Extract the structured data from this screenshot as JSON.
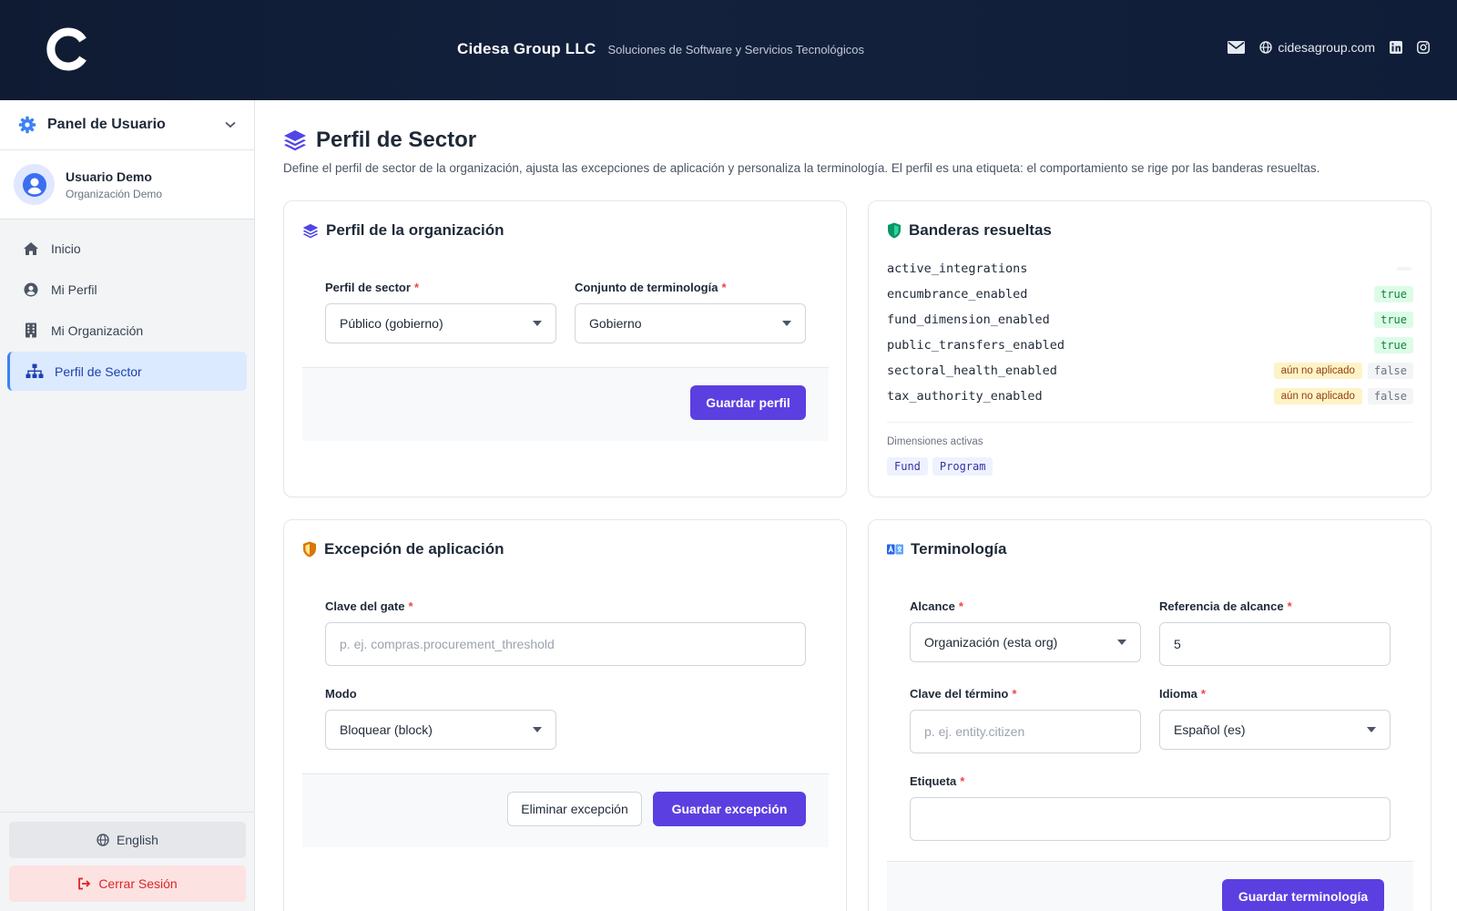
{
  "header": {
    "company": "Cidesa Group LLC",
    "tagline": "Soluciones de Software y Servicios Tecnológicos",
    "website": "cidesagroup.com",
    "logo_icon": "c-logo-icon"
  },
  "sidebar": {
    "panel_title": "Panel de Usuario",
    "user_name": "Usuario Demo",
    "user_org": "Organización Demo",
    "items": [
      {
        "label": "Inicio",
        "icon": "home-icon"
      },
      {
        "label": "Mi Perfil",
        "icon": "user-circle-icon"
      },
      {
        "label": "Mi Organización",
        "icon": "building-icon"
      },
      {
        "label": "Perfil de Sector",
        "icon": "sitemap-icon",
        "active": true
      }
    ],
    "language_label": "English",
    "logout_label": "Cerrar Sesión"
  },
  "page": {
    "title": "Perfil de Sector",
    "description": "Define el perfil de sector de la organización, ajusta las excepciones de aplicación y personaliza la terminología. El perfil es una etiqueta: el comportamiento se rige por las banderas resueltas."
  },
  "org_profile": {
    "title": "Perfil de la organización",
    "sector_label": "Perfil de sector",
    "sector_value": "Público (gobierno)",
    "terminology_label": "Conjunto de terminología",
    "terminology_value": "Gobierno",
    "save_label": "Guardar perfil"
  },
  "flags": {
    "title": "Banderas resueltas",
    "rows": [
      {
        "name": "active_integrations",
        "value": "",
        "note": ""
      },
      {
        "name": "encumbrance_enabled",
        "value": "true",
        "note": ""
      },
      {
        "name": "fund_dimension_enabled",
        "value": "true",
        "note": ""
      },
      {
        "name": "public_transfers_enabled",
        "value": "true",
        "note": ""
      },
      {
        "name": "sectoral_health_enabled",
        "value": "false",
        "note": "aún no aplicado"
      },
      {
        "name": "tax_authority_enabled",
        "value": "false",
        "note": "aún no aplicado"
      }
    ],
    "dims_label": "Dimensiones activas",
    "dims": [
      "Fund",
      "Program"
    ]
  },
  "exception": {
    "title": "Excepción de aplicación",
    "gate_label": "Clave del gate",
    "gate_placeholder": "p. ej. compras.procurement_threshold",
    "mode_label": "Modo",
    "mode_value": "Bloquear (block)",
    "delete_label": "Eliminar excepción",
    "save_label": "Guardar excepción"
  },
  "terminology": {
    "title": "Terminología",
    "scope_label": "Alcance",
    "scope_value": "Organización (esta org)",
    "scope_ref_label": "Referencia de alcance",
    "scope_ref_value": "5",
    "term_key_label": "Clave del término",
    "term_key_placeholder": "p. ej. entity.citizen",
    "language_label": "Idioma",
    "language_value": "Español (es)",
    "tag_label": "Etiqueta",
    "save_label": "Guardar terminología"
  },
  "colors": {
    "accent": "#5b3fe0",
    "header_bg": "#0f1b33",
    "true_badge": "#dcfce7",
    "warn_badge": "#fef3c7"
  }
}
